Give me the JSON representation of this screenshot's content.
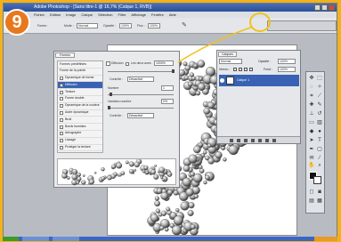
{
  "badge": "9",
  "window": {
    "title": "Adobe Photoshop - [Sans titre-1 @ 16,7% (Calque 1, RVB)]"
  },
  "menu": [
    "Fichier",
    "Edition",
    "Image",
    "Calque",
    "Sélection",
    "Filtre",
    "Affichage",
    "Fenêtre",
    "Aide"
  ],
  "options": {
    "brush_label": "Forme :",
    "mode_label": "Mode :",
    "mode_value": "Normal",
    "opacity_label": "Opacité :",
    "opacity_value": "100%",
    "flow_label": "Flux :",
    "flow_value": "100%"
  },
  "brushes_panel": {
    "tab": "Formes",
    "items": [
      "Formes prédéfinies",
      "Forme de la pointe",
      "Dynamique de forme",
      "Diffusion",
      "Texture",
      "Forme double",
      "Dynamique de la couleur",
      "Autre dynamique",
      "Bruit",
      "Bords humides",
      "Aérographe",
      "Lissage",
      "Protéger la texture"
    ],
    "selected_index": 3,
    "scatter_label": "Diffusion",
    "both_axes_label": "Les deux axes",
    "scatter_value": "1000%",
    "control_label": "Contrôle :",
    "control_value": "Désactivé",
    "count_label": "Nombre",
    "count_value": "1",
    "count_jitter_label": "Variation nombre",
    "count_jitter_value": "0%",
    "control2_label": "Contrôle :",
    "control2_value": "Désactivé"
  },
  "layers_panel": {
    "tab": "Calques",
    "blend_mode": "Normal",
    "opacity_label": "Opacité :",
    "opacity_value": "100%",
    "lock_label": "Verrou :",
    "fill_label": "Fond :",
    "fill_value": "100%",
    "layer_name": "Calque 1"
  }
}
